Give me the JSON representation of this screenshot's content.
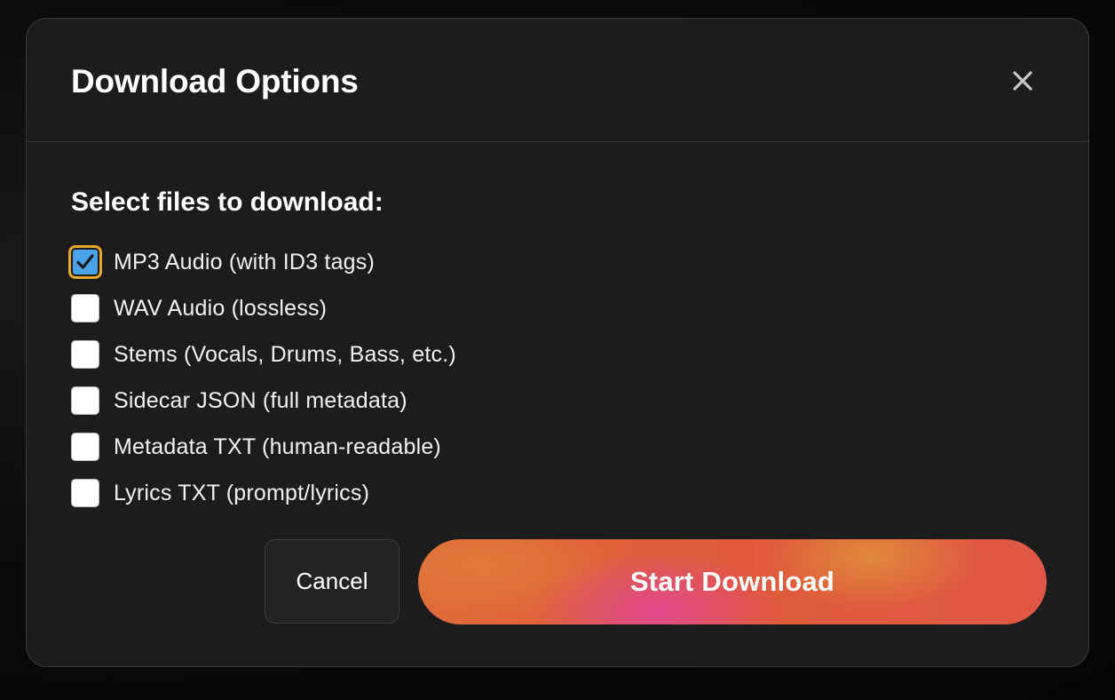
{
  "dialog": {
    "title": "Download Options",
    "close_icon": "close-icon",
    "section_label": "Select files to download:",
    "options": [
      {
        "label": "MP3 Audio (with ID3 tags)",
        "checked": true
      },
      {
        "label": "WAV Audio (lossless)",
        "checked": false
      },
      {
        "label": "Stems (Vocals, Drums, Bass, etc.)",
        "checked": false
      },
      {
        "label": "Sidecar JSON (full metadata)",
        "checked": false
      },
      {
        "label": "Metadata TXT (human-readable)",
        "checked": false
      },
      {
        "label": "Lyrics TXT (prompt/lyrics)",
        "checked": false
      }
    ],
    "cancel_label": "Cancel",
    "start_label": "Start Download"
  },
  "colors": {
    "modal_bg": "#1c1c1c",
    "checkbox_checked": "#4aa3e8",
    "focus_ring": "#e8a72a",
    "primary_gradient_start": "#e06a3a",
    "primary_gradient_accent": "#e0478e"
  }
}
